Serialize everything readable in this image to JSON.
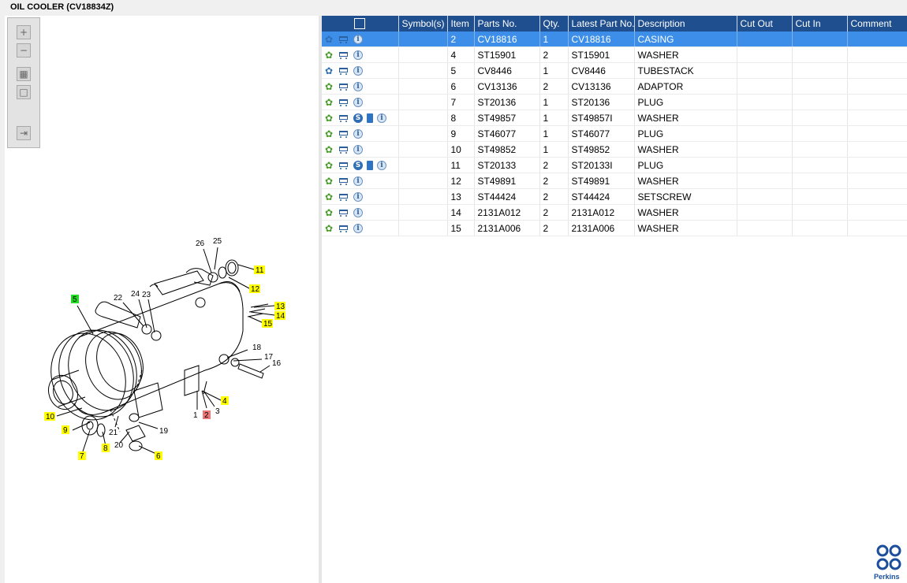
{
  "window": {
    "title": "OIL COOLER (CV18834Z)"
  },
  "toolbox": {
    "buttons": [
      "zoom-in",
      "zoom-out",
      "fit-all",
      "fit-window",
      "export"
    ]
  },
  "diagram": {
    "callouts": [
      {
        "label": "26"
      },
      {
        "label": "25"
      },
      {
        "label": "11",
        "highlight": "yellow"
      },
      {
        "label": "12",
        "highlight": "yellow"
      },
      {
        "label": "22"
      },
      {
        "label": "24"
      },
      {
        "label": "23"
      },
      {
        "label": "5",
        "highlight": "green"
      },
      {
        "label": "13",
        "highlight": "yellow"
      },
      {
        "label": "14",
        "highlight": "yellow"
      },
      {
        "label": "15",
        "highlight": "yellow"
      },
      {
        "label": "18"
      },
      {
        "label": "17"
      },
      {
        "label": "16"
      },
      {
        "label": "4",
        "highlight": "yellow"
      },
      {
        "label": "1"
      },
      {
        "label": "2",
        "highlight": "red"
      },
      {
        "label": "3"
      },
      {
        "label": "10",
        "highlight": "yellow"
      },
      {
        "label": "9",
        "highlight": "yellow"
      },
      {
        "label": "21"
      },
      {
        "label": "19"
      },
      {
        "label": "20"
      },
      {
        "label": "8",
        "highlight": "yellow"
      },
      {
        "label": "7",
        "highlight": "yellow"
      },
      {
        "label": "6",
        "highlight": "yellow"
      }
    ],
    "highlight_colors": {
      "yellow": "#ffff00",
      "green": "#22dd22",
      "red": "#ee7777"
    }
  },
  "grid": {
    "columns": [
      "",
      "Symbol(s)",
      "Item",
      "Parts No.",
      "Qty.",
      "Latest Part No.",
      "Description",
      "Cut Out",
      "Cut In",
      "Comment"
    ],
    "header_icon": "search-icon",
    "rows": [
      {
        "item": "2",
        "part_no": "CV18816",
        "qty": "1",
        "latest": "CV18816",
        "desc": "CASING",
        "icons": [
          "gear-blue",
          "cart",
          "info"
        ],
        "selected": true
      },
      {
        "item": "4",
        "part_no": "ST15901",
        "qty": "2",
        "latest": "ST15901",
        "desc": "WASHER",
        "icons": [
          "gear",
          "cart",
          "info"
        ]
      },
      {
        "item": "5",
        "part_no": "CV8446",
        "qty": "1",
        "latest": "CV8446",
        "desc": "TUBESTACK",
        "icons": [
          "gear-blue",
          "cart",
          "info"
        ]
      },
      {
        "item": "6",
        "part_no": "CV13136",
        "qty": "2",
        "latest": "CV13136",
        "desc": "ADAPTOR",
        "icons": [
          "gear",
          "cart",
          "info"
        ]
      },
      {
        "item": "7",
        "part_no": "ST20136",
        "qty": "1",
        "latest": "ST20136",
        "desc": "PLUG",
        "icons": [
          "gear",
          "cart",
          "info"
        ]
      },
      {
        "item": "8",
        "part_no": "ST49857",
        "qty": "1",
        "latest": "ST49857I",
        "desc": "WASHER",
        "icons": [
          "gear",
          "cart",
          "s",
          "book",
          "info"
        ]
      },
      {
        "item": "9",
        "part_no": "ST46077",
        "qty": "1",
        "latest": "ST46077",
        "desc": "PLUG",
        "icons": [
          "gear",
          "cart",
          "info"
        ]
      },
      {
        "item": "10",
        "part_no": "ST49852",
        "qty": "1",
        "latest": "ST49852",
        "desc": "WASHER",
        "icons": [
          "gear",
          "cart",
          "info"
        ]
      },
      {
        "item": "11",
        "part_no": "ST20133",
        "qty": "2",
        "latest": "ST20133I",
        "desc": "PLUG",
        "icons": [
          "gear",
          "cart",
          "s",
          "book",
          "info"
        ]
      },
      {
        "item": "12",
        "part_no": "ST49891",
        "qty": "2",
        "latest": "ST49891",
        "desc": "WASHER",
        "icons": [
          "gear",
          "cart",
          "info"
        ]
      },
      {
        "item": "13",
        "part_no": "ST44424",
        "qty": "2",
        "latest": "ST44424",
        "desc": "SETSCREW",
        "icons": [
          "gear",
          "cart",
          "info"
        ]
      },
      {
        "item": "14",
        "part_no": "2131A012",
        "qty": "2",
        "latest": "2131A012",
        "desc": "WASHER",
        "icons": [
          "gear",
          "cart",
          "info"
        ]
      },
      {
        "item": "15",
        "part_no": "2131A006",
        "qty": "2",
        "latest": "2131A006",
        "desc": "WASHER",
        "icons": [
          "gear",
          "cart",
          "info"
        ]
      }
    ]
  },
  "brand": {
    "logo_text": "Perkins",
    "color": "#1b4f9c"
  },
  "colors": {
    "header_bg": "#1f4f8f",
    "selected_row": "#3c8ee8"
  }
}
